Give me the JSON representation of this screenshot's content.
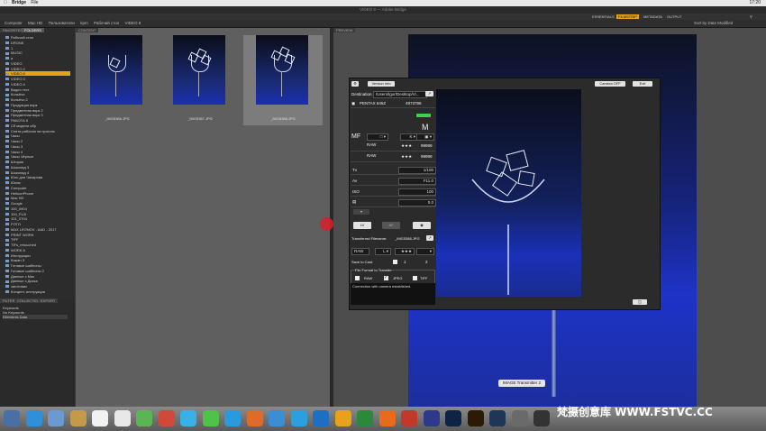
{
  "menubar": {
    "app": "Bridge",
    "items": [
      "File"
    ],
    "right": "17:20"
  },
  "window": {
    "title": "VIDEO 8 — Adobe Bridge"
  },
  "workspaces": [
    "ESSENTIALS",
    "FILMSTRIP",
    "METADATA",
    "OUTPUT"
  ],
  "sort": "Sort by Date Modified",
  "path": [
    "Computer",
    "Mac HD",
    "Пользователи",
    "kpm",
    "Рабочий стол",
    "VIDEO 8"
  ],
  "left_tabs": [
    "FAVORITES",
    "FOLDERS"
  ],
  "folders": [
    {
      "label": "Рабочий стол",
      "selected": false
    },
    {
      "label": "DRONE",
      "selected": false
    },
    {
      "label": "1",
      "selected": false
    },
    {
      "label": "MUSIC",
      "selected": false
    },
    {
      "label": "a",
      "selected": false
    },
    {
      "label": "VIDEO",
      "selected": false
    },
    {
      "label": "VIDEO 2",
      "selected": false
    },
    {
      "label": "VIDEO 8",
      "selected": true
    },
    {
      "label": "VIDEO 3",
      "selected": false
    },
    {
      "label": "VIDEO 4",
      "selected": false
    },
    {
      "label": "Видео тест",
      "selected": false
    },
    {
      "label": "Кольёчи",
      "selected": false
    },
    {
      "label": "Кольёчи 2",
      "selected": false
    },
    {
      "label": "Продукция ворк",
      "selected": false
    },
    {
      "label": "Предметная ворк 2",
      "selected": false
    },
    {
      "label": "Предметная ворк 3",
      "selected": false
    },
    {
      "label": "РАБОТА 5",
      "selected": false
    },
    {
      "label": "Сб модели обр",
      "selected": false
    },
    {
      "label": "Снята рабочая на прогонк",
      "selected": false
    },
    {
      "label": "Часы",
      "selected": false
    },
    {
      "label": "Часы 2",
      "selected": false
    },
    {
      "label": "Часы 3",
      "selected": false
    },
    {
      "label": "Часы 4",
      "selected": false
    },
    {
      "label": "Часы Чёрные",
      "selected": false
    },
    {
      "label": "Шторки",
      "selected": false
    },
    {
      "label": "Шоколад 3",
      "selected": false
    },
    {
      "label": "Шоколад 4",
      "selected": false
    },
    {
      "label": "Юль для Чахарова",
      "selected": false
    },
    {
      "label": "Юлия",
      "selected": false
    },
    {
      "label": "Computer",
      "selected": false
    },
    {
      "label": "HelloonPhone",
      "selected": false
    },
    {
      "label": "Mac HD",
      "selected": false
    },
    {
      "label": "Google",
      "selected": false
    },
    {
      "label": "100_0904",
      "selected": false
    },
    {
      "label": "100_FUJI",
      "selected": false
    },
    {
      "label": "101_0704",
      "selected": false
    },
    {
      "label": "FOTO",
      "selected": false
    },
    {
      "label": "MAX LEONOV - AAD - 2017",
      "selected": false
    },
    {
      "label": "PRINT WORK",
      "selected": false
    },
    {
      "label": "TIFF",
      "selected": false
    },
    {
      "label": "TIFs_retouched",
      "selected": false
    },
    {
      "label": "WORK 8",
      "selected": false
    },
    {
      "label": "Инструкции",
      "selected": false
    },
    {
      "label": "Кожан 3",
      "selected": false
    },
    {
      "label": "Готовые шаблоны",
      "selected": false
    },
    {
      "label": "Готовые шаблоны 2",
      "selected": false
    },
    {
      "label": "Данные с Мас",
      "selected": false
    },
    {
      "label": "Данные с Диска",
      "selected": false
    },
    {
      "label": "заготовки",
      "selected": false
    },
    {
      "label": "Концепт, инструкции",
      "selected": false
    }
  ],
  "bottom_tabs": [
    "FILTER",
    "COLLECTIONS",
    "EXPORT"
  ],
  "keywords": {
    "title": "Keywords",
    "rows": [
      "No Keywords",
      "Ellements Data"
    ]
  },
  "content_tab": "CONTENT",
  "thumbs": [
    {
      "label": "_IMG5386.JPG",
      "selected": false
    },
    {
      "label": "_IMG5387.JPG",
      "selected": false
    },
    {
      "label": "_IMG5388.JPG",
      "selected": true
    }
  ],
  "preview_tab": "PREVIEW",
  "transmitter": {
    "version_btn": "Version Info",
    "camera_off": "Camera OFF",
    "exit": "Exit",
    "destination_label": "Destination",
    "destination_value": "/Users/lgor/Desktop/Vi...",
    "camera_model": "PENTAX 645Z",
    "serial": "4973786",
    "mode": "M",
    "focus": "MF",
    "quality1": "99999",
    "quality2": "99999",
    "tv_label": "Tv",
    "tv_value": "1/100",
    "av_label": "Av",
    "av_value": "F11.0",
    "iso_label": "ISO",
    "iso_value": "100",
    "ev_value": "0.0",
    "lv_btn": "LV",
    "af_btn": "AF",
    "transferred_label": "Transferred Filename:",
    "transferred_value": "_IMG5388.JPG",
    "save_to_card": "Save to Card",
    "slot1": "1",
    "slot2": "2",
    "format_title": "File Format to Transfer",
    "fmt_raw": "RAW",
    "fmt_jpeg": "JPEG",
    "fmt_tiff": "TIFF",
    "status": "Connection with camera established."
  },
  "tooltip": "IMAGE Transmitter 2",
  "watermark": "梵摄创意库 WWW.FSTVC.CC",
  "colors": {
    "accent": "#e8a21a",
    "preview_blue": "#1d33c8"
  }
}
